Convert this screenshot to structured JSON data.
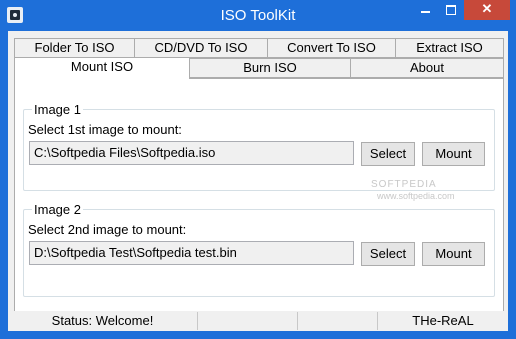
{
  "window": {
    "title": "ISO ToolKit",
    "close_label": "✕"
  },
  "tabs_row1": [
    {
      "label": "Folder To ISO"
    },
    {
      "label": "CD/DVD To ISO"
    },
    {
      "label": "Convert To ISO"
    },
    {
      "label": "Extract ISO"
    }
  ],
  "tabs_row2": [
    {
      "label": "Mount ISO"
    },
    {
      "label": "Burn ISO"
    },
    {
      "label": "About"
    }
  ],
  "image1": {
    "legend": "Image 1",
    "prompt": "Select 1st image to mount:",
    "path": "C:\\Softpedia Files\\Softpedia.iso",
    "select_label": "Select",
    "mount_label": "Mount"
  },
  "image2": {
    "legend": "Image 2",
    "prompt": "Select 2nd image to mount:",
    "path": "D:\\Softpedia Test\\Softpedia test.bin",
    "select_label": "Select",
    "mount_label": "Mount"
  },
  "status": {
    "message": "Status: Welcome!",
    "author": "THe-ReAL"
  },
  "watermark": {
    "brand": "SOFTPEDIA",
    "url": "www.softpedia.com"
  }
}
